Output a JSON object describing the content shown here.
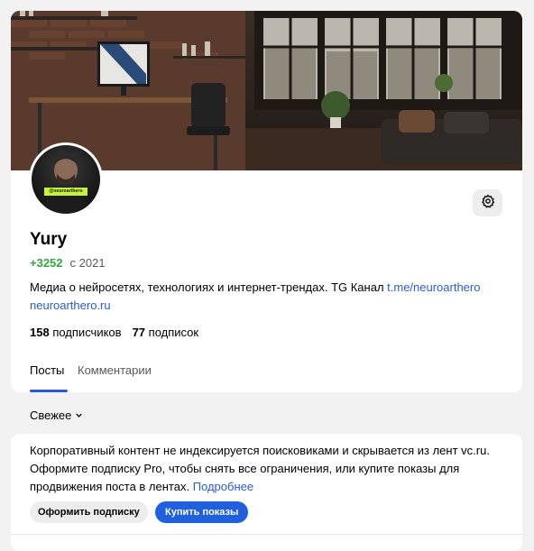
{
  "profile": {
    "name": "Yury",
    "rating": "+3252",
    "since": "с 2021",
    "avatar_badge": "@neuroarthero",
    "description_text": "Медиа о нейросетях, технологиях и интернет-трендах. TG Канал ",
    "telegram_link": "t.me/neuroarthero",
    "website_link": "neuroarthero.ru",
    "subscribers_count": "158",
    "subscribers_label": "подписчиков",
    "subscriptions_count": "77",
    "subscriptions_label": "подписок"
  },
  "tabs": [
    {
      "label": "Посты",
      "active": true
    },
    {
      "label": "Комментарии",
      "active": false
    }
  ],
  "sort": {
    "label": "Свежее"
  },
  "notice": {
    "text": "Корпоративный контент не индексируется поисковиками и скрывается из лент vc.ru. Оформите подписку Pro, чтобы снять все ограничения, или купите показы для продвижения поста в лентах. ",
    "more_link": "Подробнее",
    "subscribe_button": "Оформить подписку",
    "buy_button": "Купить показы"
  },
  "icons": {
    "settings": "gear-icon",
    "sort_chevron": "chevron-down-icon"
  },
  "colors": {
    "accent": "#2a5bd7",
    "rating": "#2ea83a",
    "primary_button": "#1f5fe0",
    "badge": "#c5f23a"
  }
}
